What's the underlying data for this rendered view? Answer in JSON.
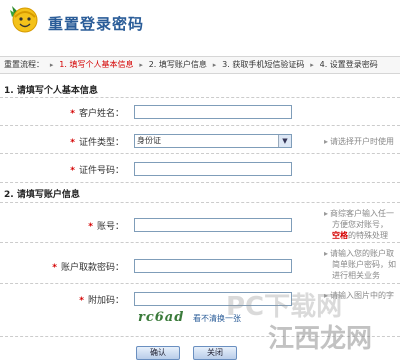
{
  "header": {
    "title": "重置登录密码"
  },
  "steps": {
    "lead": "重置流程：",
    "items": [
      "1. 填写个人基本信息",
      "2. 填写账户信息",
      "3. 获取手机短信验证码",
      "4. 设置登录密码"
    ],
    "active_index": 0
  },
  "section1": {
    "title": "1. 请填写个人基本信息",
    "name_label": "客户姓名：",
    "id_type_label": "证件类型：",
    "id_type_value": "身份证",
    "id_type_hint": "请选择开户时使用",
    "id_number_label": "证件号码："
  },
  "section2": {
    "title": "2. 请填写账户信息",
    "account_label": "账号：",
    "account_hint_1": "商综客户输入任一",
    "account_hint_2": "方便您对账号，",
    "account_hint_3_red": "空格",
    "account_hint_3_rest": "的特殊处理",
    "password_label": "账户取款密码：",
    "password_hint_1": "请输入您的账户取",
    "password_hint_2": "简单账户密码，如",
    "password_hint_3": "进行相关业务",
    "captcha_label": "附加码：",
    "captcha_hint": "请输入图片中的字",
    "captcha_text": "rc6ad",
    "refresh_label": "看不清换一张"
  },
  "buttons": {
    "confirm": "确认",
    "close": "关闭"
  },
  "watermark": {
    "text_1": "PC下载网",
    "text_2": "江西龙网"
  },
  "colors": {
    "title": "#2a5c98",
    "active_step": "#d40000",
    "required": "#d40000"
  }
}
